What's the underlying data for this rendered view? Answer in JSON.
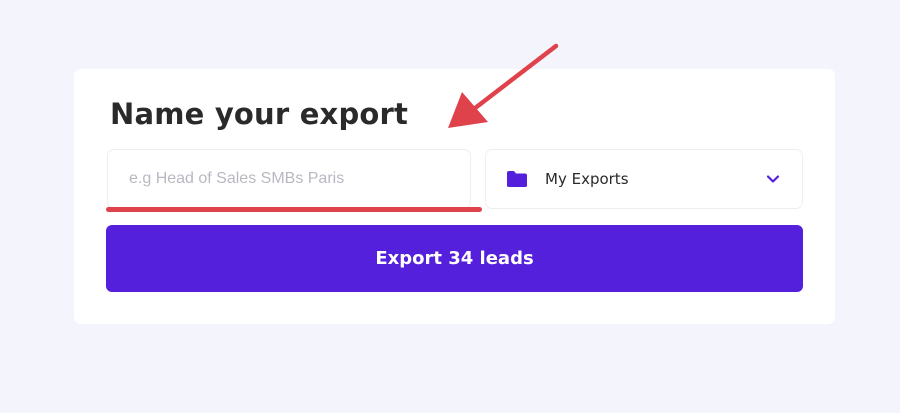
{
  "export_form": {
    "title": "Name your export",
    "name_input": {
      "value": "",
      "placeholder": "e.g Head of Sales SMBs Paris"
    },
    "folder_select": {
      "selected": "My Exports",
      "icon": "folder-icon",
      "dropdown_icon": "chevron-down-icon"
    },
    "export_button_label": "Export 34 leads"
  },
  "colors": {
    "accent": "#5420dc",
    "annotation": "#e0424b",
    "background": "#f4f4fd",
    "card": "#ffffff",
    "title_text": "#2a2a2a",
    "placeholder": "#b8b8c2"
  }
}
